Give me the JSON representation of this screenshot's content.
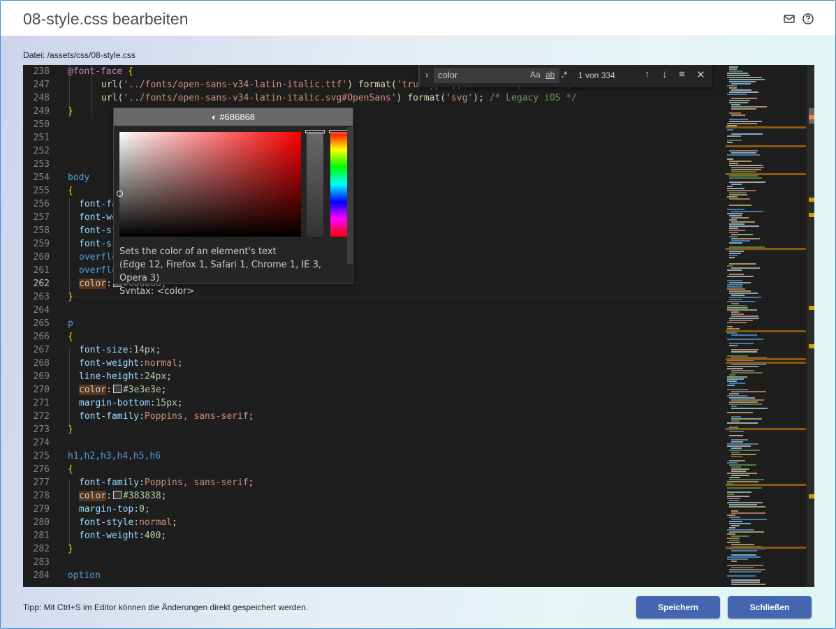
{
  "dialog": {
    "title": "08-style.css bearbeiten",
    "file_label": "Datei: /assets/css/08-style.css"
  },
  "find_widget": {
    "query": "color",
    "match_case": "Aa",
    "whole_word": "ab",
    "regex": ".*",
    "count": "1 von 334"
  },
  "color_picker": {
    "header": "#686868",
    "description": "Sets the color of an element's text",
    "compat": "(Edge 12, Firefox 1, Safari 1, Chrome 1, IE 3, Opera 3)",
    "syntax": "Syntax: <color>"
  },
  "code_lines": [
    {
      "n": "238",
      "text": "@font-face {"
    },
    {
      "n": "247",
      "text": "url('../fonts/open-sans-v34-latin-italic.ttf') format('truetype'), /* Safari, Android, iOS */"
    },
    {
      "n": "248",
      "text": "url('../fonts/open-sans-v34-latin-italic.svg#OpenSans') format('svg'); /* Legacy iOS */"
    },
    {
      "n": "249",
      "text": "}"
    },
    {
      "n": "250",
      "text": ""
    },
    {
      "n": "251",
      "text": ""
    },
    {
      "n": "252",
      "text": ""
    },
    {
      "n": "253",
      "text": ""
    },
    {
      "n": "254",
      "text": "body"
    },
    {
      "n": "255",
      "text": "{"
    },
    {
      "n": "256",
      "text": "font-fa"
    },
    {
      "n": "257",
      "text": "font-we"
    },
    {
      "n": "258",
      "text": "font-st"
    },
    {
      "n": "259",
      "text": "font-si"
    },
    {
      "n": "260",
      "text": "overflo"
    },
    {
      "n": "261",
      "text": "overflo"
    },
    {
      "n": "262",
      "text": "color: #686868;"
    },
    {
      "n": "263",
      "text": "}"
    },
    {
      "n": "264",
      "text": ""
    },
    {
      "n": "265",
      "text": "p"
    },
    {
      "n": "266",
      "text": "{"
    },
    {
      "n": "267",
      "text": "font-size:14px;"
    },
    {
      "n": "268",
      "text": "font-weight:normal;"
    },
    {
      "n": "269",
      "text": "line-height:24px;"
    },
    {
      "n": "270",
      "text": "color: #3e3e3e;"
    },
    {
      "n": "271",
      "text": "margin-bottom:15px;"
    },
    {
      "n": "272",
      "text": "font-family:Poppins, sans-serif;"
    },
    {
      "n": "273",
      "text": "}"
    },
    {
      "n": "274",
      "text": ""
    },
    {
      "n": "275",
      "text": "h1,h2,h3,h4,h5,h6"
    },
    {
      "n": "276",
      "text": "{"
    },
    {
      "n": "277",
      "text": "font-family:Poppins, sans-serif;"
    },
    {
      "n": "278",
      "text": "color: #383838;"
    },
    {
      "n": "279",
      "text": "margin-top:0;"
    },
    {
      "n": "280",
      "text": "font-style:normal;"
    },
    {
      "n": "281",
      "text": "font-weight:400;"
    },
    {
      "n": "282",
      "text": "}"
    },
    {
      "n": "283",
      "text": ""
    },
    {
      "n": "284",
      "text": "option"
    }
  ],
  "footer": {
    "tip": "Tipp: Mit Ctrl+S im Editor können die Änderungen direkt gespeichert werden.",
    "save_label": "Speichern",
    "close_label": "Schließen"
  },
  "colors": {
    "accent": "#4466b0",
    "editor_bg": "#1e1e1e",
    "picked_color": "#686868"
  }
}
